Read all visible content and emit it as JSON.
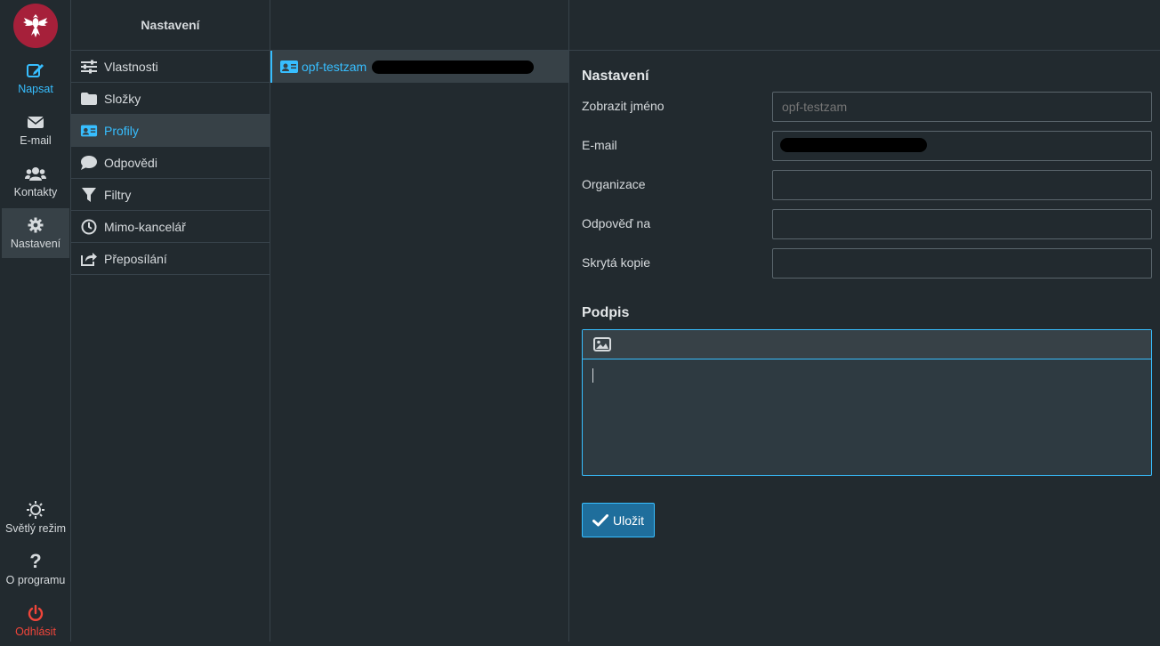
{
  "nav": {
    "compose": "Napsat",
    "email": "E-mail",
    "contacts": "Kontakty",
    "settings": "Nastavení",
    "light_mode": "Světlý režim",
    "about": "O programu",
    "logout": "Odhlásit"
  },
  "menu": {
    "title": "Nastavení",
    "items": [
      {
        "label": "Vlastnosti",
        "icon": "sliders-icon"
      },
      {
        "label": "Složky",
        "icon": "folder-icon"
      },
      {
        "label": "Profily",
        "icon": "id-card-icon",
        "active": true
      },
      {
        "label": "Odpovědi",
        "icon": "speech-bubble-icon"
      },
      {
        "label": "Filtry",
        "icon": "filter-icon"
      },
      {
        "label": "Mimo-kancelář",
        "icon": "clock-icon"
      },
      {
        "label": "Přeposílání",
        "icon": "share-icon"
      }
    ]
  },
  "identities": [
    {
      "name": "opf-testzam",
      "email_redacted": true
    }
  ],
  "form": {
    "title": "Nastavení",
    "fields": {
      "display_name": {
        "label": "Zobrazit jméno",
        "value": "opf-testzam"
      },
      "email": {
        "label": "E-mail",
        "value": "",
        "redacted": true
      },
      "organization": {
        "label": "Organizace",
        "value": ""
      },
      "reply_to": {
        "label": "Odpověď na",
        "value": ""
      },
      "bcc": {
        "label": "Skrytá kopie",
        "value": ""
      }
    },
    "signature_title": "Podpis",
    "save_label": "Uložit"
  },
  "colors": {
    "accent": "#37beff",
    "background": "#222a2f",
    "selected": "#374147",
    "logout": "#f0453a",
    "logo": "#a6203a"
  }
}
